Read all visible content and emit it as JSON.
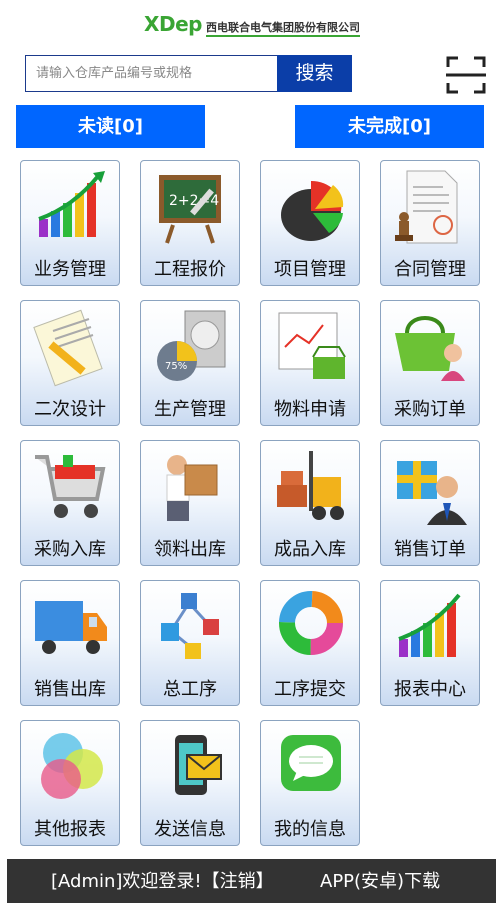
{
  "header": {
    "brand": "XDep",
    "company": "西电联合电气集团股份有限公司"
  },
  "search": {
    "placeholder": "请输入仓库产品编号或规格",
    "button": "搜索"
  },
  "tabs": {
    "unread": "未读[0]",
    "incomplete": "未完成[0]"
  },
  "menu": [
    {
      "label": "业务管理",
      "icon": "bar-chart-growth-icon"
    },
    {
      "label": "工程报价",
      "icon": "chalkboard-math-icon"
    },
    {
      "label": "项目管理",
      "icon": "pie-chart-icon"
    },
    {
      "label": "合同管理",
      "icon": "contract-stamp-icon"
    },
    {
      "label": "二次设计",
      "icon": "notepad-pencil-icon"
    },
    {
      "label": "生产管理",
      "icon": "hard-drive-progress-icon"
    },
    {
      "label": "物料申请",
      "icon": "chart-basket-icon"
    },
    {
      "label": "采购订单",
      "icon": "shopping-basket-person-icon"
    },
    {
      "label": "采购入库",
      "icon": "shopping-cart-icon"
    },
    {
      "label": "领料出库",
      "icon": "delivery-man-box-icon"
    },
    {
      "label": "成品入库",
      "icon": "forklift-icon"
    },
    {
      "label": "销售订单",
      "icon": "gift-businessman-icon"
    },
    {
      "label": "销售出库",
      "icon": "delivery-truck-icon"
    },
    {
      "label": "总工序",
      "icon": "process-cubes-icon"
    },
    {
      "label": "工序提交",
      "icon": "ring-chart-icon"
    },
    {
      "label": "报表中心",
      "icon": "report-bar-chart-icon"
    },
    {
      "label": "其他报表",
      "icon": "colored-circles-icon"
    },
    {
      "label": "发送信息",
      "icon": "phone-envelope-icon"
    },
    {
      "label": "我的信息",
      "icon": "message-bubble-icon"
    }
  ],
  "footer": {
    "welcome": "[Admin]欢迎登录!",
    "logout": "【注销】",
    "app_download": "APP(安卓)下载"
  },
  "colors": {
    "primary": "#0066ff",
    "search_button": "#0b3ea8",
    "footer": "#333333",
    "brand": "#3aa534"
  }
}
